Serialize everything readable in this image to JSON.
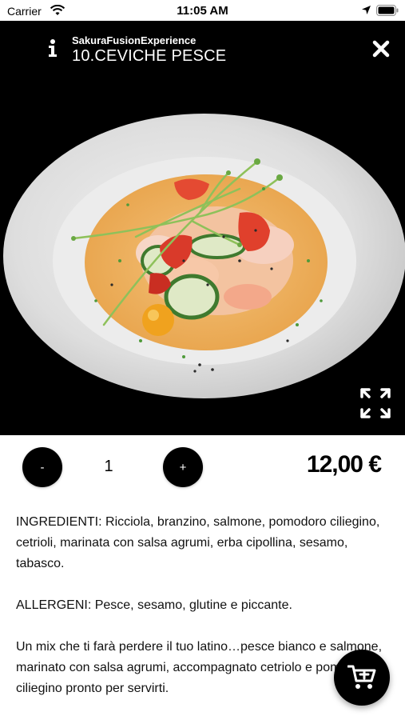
{
  "status_bar": {
    "carrier": "Carrier",
    "time": "11:05 AM",
    "icons": [
      "wifi-icon",
      "location-arrow-icon",
      "battery-icon"
    ]
  },
  "header": {
    "brand": "SakuraFusionExperience",
    "title": "10.CEVICHE PESCE",
    "icons": [
      "info-icon",
      "close-icon",
      "expand-icon"
    ]
  },
  "product": {
    "quantity": "1",
    "minus_label": "-",
    "plus_label": "+",
    "price": "12,00 €"
  },
  "description": {
    "ingredients": "INGREDIENTI: Ricciola, branzino, salmone, pomodoro ciliegino, cetrioli, marinata con salsa agrumi, erba cipollina, sesamo, tabasco.",
    "allergens": "ALLERGENI: Pesce, sesamo, glutine e piccante.",
    "text": "Un mix che ti farà perdere il tuo latino…pesce bianco e salmone, marinato con salsa agrumi, accompagnato cetriolo e pomodoro ciliegino pronto per servirti."
  },
  "cart_button": {
    "icon": "cart-add-icon"
  },
  "colors": {
    "accent": "#000000",
    "background": "#ffffff"
  }
}
